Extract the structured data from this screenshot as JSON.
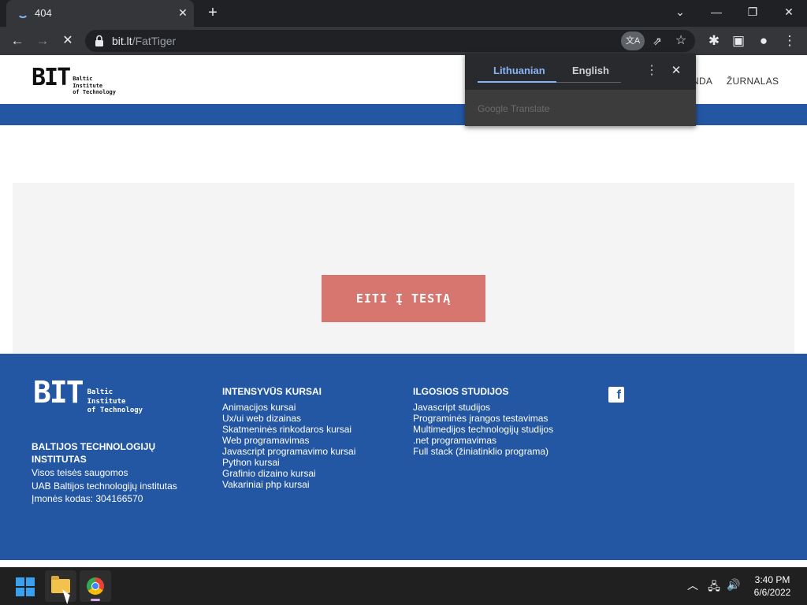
{
  "browser": {
    "tab_title": "404",
    "url_host": "bit.lt",
    "url_path": "/FatTiger"
  },
  "site": {
    "logo_mark": "BIT",
    "logo_lines": [
      "Baltic",
      "Institute",
      "of Technology"
    ],
    "nav_items": [
      "NDA",
      "ŽURNALAS"
    ],
    "cta_label": "EITI Į TESTĄ"
  },
  "footer": {
    "company_name": "BALTIJOS TECHNOLOGIJŲ INSTITUTAS",
    "company_lines": [
      "Visos teisės saugomos",
      "UAB Baltijos technologijų institutas",
      "Įmonės kodas: 304166570"
    ],
    "intensive": {
      "heading": "INTENSYVŪS KURSAI",
      "links": [
        "Animacijos kursai",
        "Ux/ui web dizainas",
        "Skatmeninės rinkodaros kursai",
        "Web programavimas",
        "Javascript programavimo kursai",
        "Python kursai",
        "Grafinio dizaino kursai",
        "Vakariniai php kursai"
      ]
    },
    "long_studies": {
      "heading": "ILGOSIOS STUDIJOS",
      "links": [
        "Javascript studijos",
        "Programinės įrangos testavimas",
        "Multimedijos technologijų studijos",
        ".net programavimas",
        "Full stack (žiniatinklio programa)"
      ]
    },
    "facebook_glyph": "f"
  },
  "translate_popup": {
    "tab_source": "Lithuanian",
    "tab_target": "English",
    "brand": "Google Translate"
  },
  "taskbar": {
    "time": "3:40 PM",
    "date": "6/6/2022"
  },
  "colors": {
    "brand_blue": "#2457a3",
    "cta_red": "#d6766f",
    "accent_blue": "#8ab4f8"
  }
}
